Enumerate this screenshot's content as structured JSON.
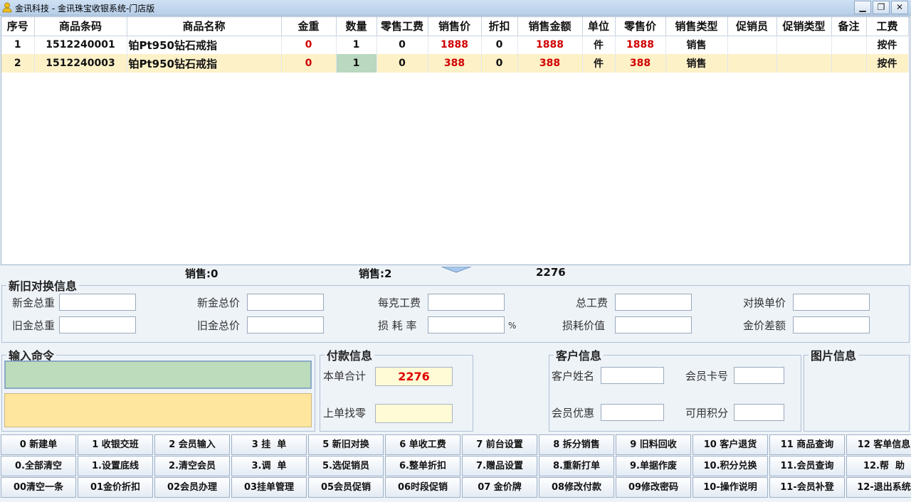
{
  "window": {
    "title": "金讯科技 - 金讯珠宝收银系统-门店版",
    "min_glyph": "▁",
    "restore_glyph": "❐",
    "close_glyph": "✕",
    "icon": "user-icon"
  },
  "grid": {
    "columns": [
      "序号",
      "商品条码",
      "商品名称",
      "金重",
      "数量",
      "零售工费",
      "销售价",
      "折扣",
      "销售金额",
      "单位",
      "零售价",
      "销售类型",
      "促销员",
      "促销类型",
      "备注",
      "工费"
    ],
    "rows": [
      [
        "1",
        "1512240001",
        "铂Pt950钻石戒指",
        "0",
        "1",
        "0",
        "1888",
        "0",
        "1888",
        "件",
        "1888",
        "销售",
        "",
        "",
        "",
        "按件"
      ],
      [
        "2",
        "1512240003",
        "铂Pt950钻石戒指",
        "0",
        "1",
        "0",
        "388",
        "0",
        "388",
        "件",
        "388",
        "销售",
        "",
        "",
        "",
        "按件"
      ]
    ]
  },
  "summary": {
    "exchange_label": "销售:0",
    "sale_label": "销售:2",
    "total": "2276"
  },
  "exchange": {
    "legend": "新旧对换信息",
    "new_weight": "新金总重",
    "new_price": "新金总价",
    "per_gram_fee": "每克工费",
    "total_fee": "总工费",
    "exchange_unit_price": "对换单价",
    "old_weight": "旧金总重",
    "old_price": "旧金总价",
    "loss_rate": "损 耗 率",
    "percent": "%",
    "loss_value": "损耗价值",
    "gold_diff": "金价差额"
  },
  "command": {
    "legend": "输入命令"
  },
  "payment": {
    "legend": "付款信息",
    "total_label": "本单合计",
    "total_value": "2276",
    "change_label": "上单找零"
  },
  "customer": {
    "legend": "客户信息",
    "name": "客户姓名",
    "card": "会员卡号",
    "discount": "会员优惠",
    "points": "可用积分"
  },
  "image_info": {
    "legend": "图片信息"
  },
  "buttons": [
    [
      "0 新建单",
      "1 收银交班",
      "2 会员输入",
      "3 挂  单",
      "5 新旧对换",
      "6 单收工费",
      "7 前台设置",
      "8 拆分销售",
      "9 旧料回收",
      "10 客户退货",
      "11 商品查询",
      "12 客单信息"
    ],
    [
      "0.全部清空",
      "1.设置底线",
      "2.清空会员",
      "3.调  单",
      "5.选促销员",
      "6.整单折扣",
      "7.赠品设置",
      "8.重新打单",
      "9.单据作废",
      "10.积分兑换",
      "11.会员查询",
      "12.帮  助"
    ],
    [
      "00清空一条",
      "01金价折扣",
      "02会员办理",
      "03挂单管理",
      "05会员促销",
      "06时段促销",
      "07 金价牌",
      "08修改付款",
      "09修改密码",
      "10-操作说明",
      "11-会员补登",
      "12-退出系统"
    ]
  ]
}
